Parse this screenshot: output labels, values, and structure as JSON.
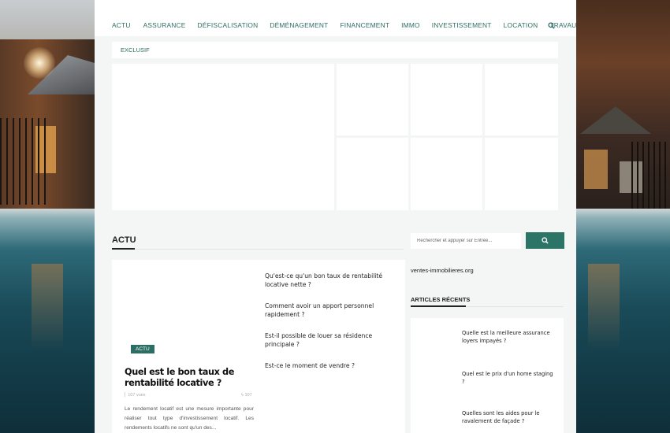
{
  "nav": {
    "items": [
      "ACTU",
      "ASSURANCE",
      "DÉFISCALISATION",
      "DÉMÉNAGEMENT",
      "FINANCEMENT",
      "IMMO",
      "INVESTISSEMENT",
      "LOCATION",
      "TRAVAUX"
    ],
    "search_icon": "search-icon"
  },
  "exclusif": {
    "label": "EXCLUSIF"
  },
  "section": {
    "title": "ACTU"
  },
  "featured": {
    "badge": "ACTU",
    "title": "Quel est le bon taux de rentabilité locative ?",
    "views": "107 vues",
    "count": "107",
    "excerpt": "Le rendement locatif est une mesure importante pour réaliser tout type d'investissement locatif. Les rendements locatifs ne sont qu'un des..."
  },
  "articles": [
    "Qu'est-ce qu'un bon taux de rentabilité locative nette ?",
    "Comment avoir un apport personnel rapidement ?",
    "Est-il possible de louer sa résidence principale ?",
    "Est-ce le moment de vendre ?"
  ],
  "sidebar": {
    "search_placeholder": "Rechercher et appuyer sur Entrée...",
    "site_name": "ventes-immobilieres.org",
    "recent_title": "ARTICLES RÉCENTS",
    "recent": [
      "Quelle est la meilleure assurance loyers impayés ?",
      "Quel est le prix d'un home staging ?",
      "Quelles sont les aides pour le ravalement de façade ?"
    ]
  },
  "colors": {
    "accent": "#2c6e63",
    "button": "#2c7466",
    "page_bg": "#f4f6f5"
  }
}
